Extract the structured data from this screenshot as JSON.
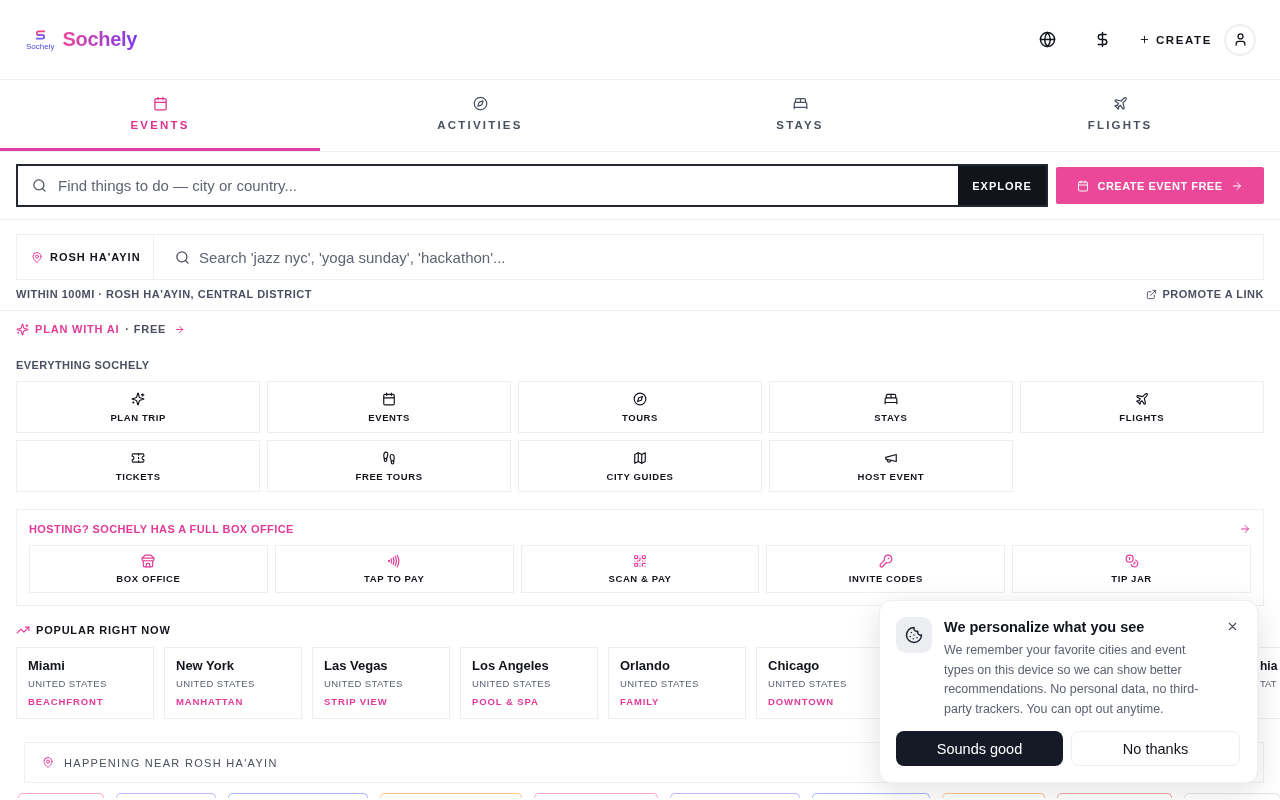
{
  "header": {
    "logo_caption": "Sochely",
    "brand": "Sochely",
    "create_label": "CREATE"
  },
  "tabs": [
    {
      "label": "EVENTS",
      "selected": true
    },
    {
      "label": "ACTIVITIES",
      "selected": false
    },
    {
      "label": "STAYS",
      "selected": false
    },
    {
      "label": "FLIGHTS",
      "selected": false
    }
  ],
  "search": {
    "placeholder": "Find things to do — city or country...",
    "button": "EXPLORE",
    "create_button": "CREATE EVENT FREE"
  },
  "location": {
    "place": "ROSH HA'AYIN",
    "placeholder": "Search 'jazz nyc', 'yoga sunday', 'hackathon'...",
    "radius": "WITHIN 100MI · ROSH HA'AYIN, CENTRAL DISTRICT",
    "promote_link": "PROMOTE A LINK"
  },
  "plan_ai": {
    "label": "PLAN WITH AI",
    "suffix": "· FREE"
  },
  "everything": {
    "title": "EVERYTHING SOCHELY",
    "items": [
      "PLAN TRIP",
      "EVENTS",
      "TOURS",
      "STAYS",
      "FLIGHTS",
      "TICKETS",
      "FREE TOURS",
      "CITY GUIDES",
      "HOST EVENT"
    ]
  },
  "hosting": {
    "title": "HOSTING? SOCHELY HAS A FULL BOX OFFICE",
    "items": [
      "BOX OFFICE",
      "TAP TO PAY",
      "SCAN & PAY",
      "INVITE CODES",
      "TIP JAR"
    ]
  },
  "popular": {
    "title": "POPULAR RIGHT NOW",
    "cities": [
      {
        "kind": "full",
        "name": "Miami",
        "country": "UNITED STATES",
        "tag": "BEACHFRONT"
      },
      {
        "kind": "full",
        "name": "New York",
        "country": "UNITED STATES",
        "tag": "MANHATTAN"
      },
      {
        "kind": "full",
        "name": "Las Vegas",
        "country": "UNITED STATES",
        "tag": "STRIP VIEW"
      },
      {
        "kind": "full",
        "name": "Los Angeles",
        "country": "UNITED STATES",
        "tag": "POOL & SPA"
      },
      {
        "kind": "full",
        "name": "Orlando",
        "country": "UNITED STATES",
        "tag": "FAMILY"
      },
      {
        "kind": "cut",
        "name": "Chicago",
        "country": "UNITED STATES",
        "tag": "DOWNTOWN"
      },
      {
        "kind": "clipped",
        "name": "hia",
        "country": "TAT"
      }
    ]
  },
  "nearby": {
    "label": "HAPPENING NEAR ROSH HA'AYIN",
    "chips": [
      {
        "color": "#f9a8c9"
      },
      {
        "color": "#c4b5fd"
      },
      {
        "color": "#a5b4fc"
      },
      {
        "color": "#fdc48a"
      },
      {
        "color": "#f9a8c9"
      },
      {
        "color": "#c4b5fd"
      },
      {
        "color": "#a5b4fc"
      },
      {
        "color": "#fdc48a"
      },
      {
        "color": "#f7a1a8"
      },
      {
        "color": "#e2e4e8"
      }
    ]
  },
  "cookie_notice": {
    "title": "We personalize what you see",
    "body": "We remember your favorite cities and event types on this device so we can show better recommendations. No personal data, no third-party trackers. You can opt out anytime.",
    "accept": "Sounds good",
    "decline": "No thanks"
  }
}
